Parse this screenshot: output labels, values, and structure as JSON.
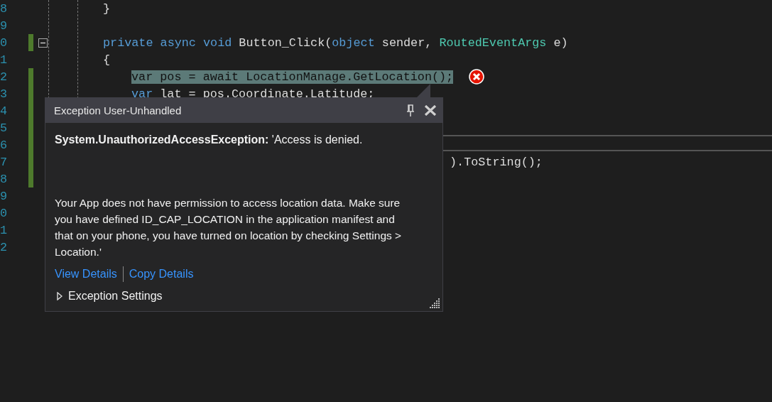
{
  "editor": {
    "lines": [
      {
        "number": "8",
        "changed": false,
        "kind": "code",
        "highlighted": false,
        "tokens": [
          {
            "kind": "plain",
            "text": "}"
          }
        ]
      },
      {
        "number": "9",
        "changed": false,
        "kind": "code"
      },
      {
        "number": "0",
        "changed": true,
        "kind": "code",
        "highlighted": false,
        "collapse": true,
        "tokens": [
          {
            "kind": "keyword",
            "text": "private"
          },
          {
            "kind": "keyword",
            "text": " async"
          },
          {
            "kind": "keyword",
            "text": " void"
          },
          {
            "kind": "plain",
            "text": " Button_Click("
          },
          {
            "kind": "keyword",
            "text": "object"
          },
          {
            "kind": "plain",
            "text": " sender, "
          },
          {
            "kind": "type",
            "text": "RoutedEventArgs"
          },
          {
            "kind": "plain",
            "text": " e)"
          }
        ]
      },
      {
        "number": "1",
        "changed": false,
        "kind": "code",
        "highlighted": false,
        "tokens": [
          {
            "kind": "plain",
            "text": "{"
          }
        ],
        "children": [
          {
            "number": "2",
            "changed": true,
            "kind": "code",
            "highlighted": true,
            "error": true,
            "tokens": [
              {
                "kind": "keyword",
                "text": "var"
              },
              {
                "kind": "plain",
                "text": " pos = "
              },
              {
                "kind": "keyword",
                "text": "await"
              },
              {
                "kind": "plain",
                "text": " LocationManage.GetLocation();"
              }
            ]
          },
          {
            "number": "3",
            "changed": true,
            "kind": "code",
            "highlighted": false,
            "tokens": [
              {
                "kind": "keyword",
                "text": "var"
              },
              {
                "kind": "plain",
                "text": " lat = pos.Coordinate.Latitude;"
              }
            ]
          },
          {
            "number": "4",
            "changed": true,
            "kind": "code"
          },
          {
            "number": "5",
            "changed": true,
            "kind": "code"
          },
          {
            "number": "6",
            "changed": true,
            "kind": "code"
          },
          {
            "number": "7",
            "changed": true,
            "kind": "fragment",
            "highlighted": false,
            "tokens": [
              {
                "kind": "plain",
                "text": ").ToString();"
              }
            ]
          },
          {
            "number": "8",
            "changed": true,
            "kind": "code"
          },
          {
            "number": "9",
            "changed": false,
            "kind": "code"
          },
          {
            "number": "0",
            "changed": false,
            "kind": "code"
          },
          {
            "number": "1",
            "changed": false,
            "kind": "code"
          },
          {
            "number": "2",
            "changed": false,
            "kind": "code"
          }
        ]
      }
    ]
  },
  "exception_popup": {
    "title": "Exception User-Unhandled",
    "exception_type": "System.UnauthorizedAccessException:",
    "exception_message": "'Access is denied.",
    "details": "Your App does not have permission to access location data. Make sure you have defined ID_CAP_LOCATION in the application manifest and that on your phone, you have turned on location by checking Settings > Location.'",
    "links": [
      "View Details",
      "Copy Details"
    ],
    "settings": {
      "label": "Exception Settings",
      "expanded": false
    }
  }
}
